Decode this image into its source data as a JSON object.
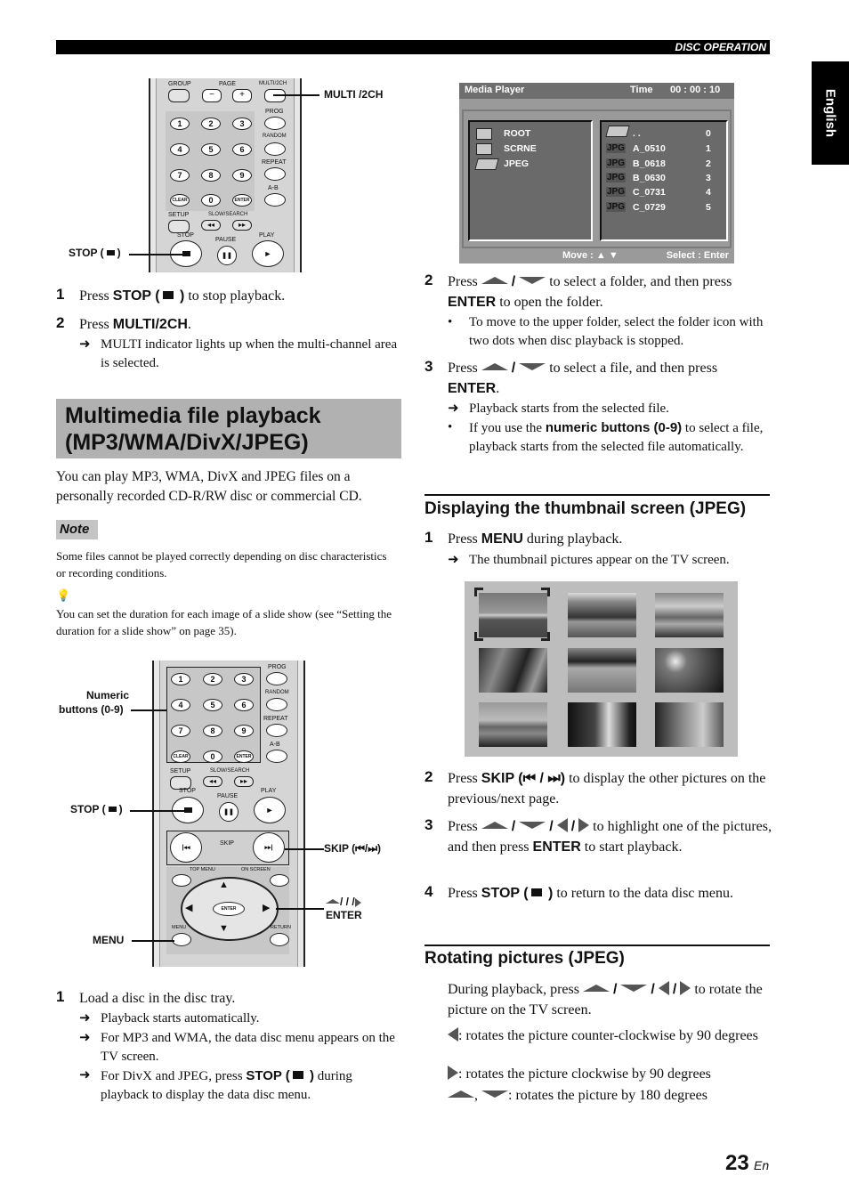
{
  "header": {
    "section": "DISC OPERATION",
    "language_tab": "English"
  },
  "remote_top": {
    "labels": {
      "group": "GROUP",
      "page": "PAGE",
      "multi2ch": "MULTI/2CH",
      "prog": "PROG",
      "random": "RANDOM",
      "repeat": "REPEAT",
      "ab": "A-B",
      "setup": "SETUP",
      "slow_search": "SLOW/SEARCH",
      "stop": "STOP",
      "pause": "PAUSE",
      "play": "PLAY",
      "clear": "CLEAR",
      "enter": "ENTER"
    },
    "numbers": [
      "1",
      "2",
      "3",
      "4",
      "5",
      "6",
      "7",
      "8",
      "9",
      "0"
    ],
    "page_minus": "−",
    "page_plus": "+",
    "callouts": {
      "multi": "MULTI /2CH",
      "stop": "STOP (",
      "stop_end": ")"
    }
  },
  "left_steps_top": [
    {
      "num": "1",
      "pre": "Press ",
      "bold": "STOP (",
      "bold_end": " )",
      "post": " to stop playback."
    },
    {
      "num": "2",
      "pre": "Press ",
      "bold": "MULTI/2CH",
      "post": ".",
      "result": "MULTI indicator lights up when the multi-channel area is selected."
    }
  ],
  "section": {
    "title_line1": "Multimedia file playback",
    "title_line2": "(MP3/WMA/DivX/JPEG)",
    "intro": "You can play MP3, WMA, DivX and JPEG files on a personally recorded CD-R/RW disc or commercial CD.",
    "note_label": "Note",
    "note_text": "Some files cannot be played correctly depending on disc characteristics or recording conditions.",
    "tip_icon": "lightbulb-tip-icon",
    "tip_text": "You can set the duration for each image of a slide show (see “Setting the duration for a slide show” on page 35)."
  },
  "remote_bottom": {
    "labels": {
      "prog": "PROG",
      "random": "RANDOM",
      "repeat": "REPEAT",
      "ab": "A-B",
      "clear": "CLEAR",
      "enter": "ENTER",
      "setup": "SETUP",
      "slow_search": "SLOW/SEARCH",
      "stop": "STOP",
      "pause": "PAUSE",
      "play": "PLAY",
      "skip": "SKIP",
      "top_menu": "TOP MENU",
      "on_screen": "ON SCREEN",
      "menu": "MENU",
      "return": "RETURN",
      "center_enter": "ENTER"
    },
    "numbers": [
      "1",
      "2",
      "3",
      "4",
      "5",
      "6",
      "7",
      "8",
      "9",
      "0"
    ],
    "callouts": {
      "numeric_1": "Numeric",
      "numeric_2": "buttons (0-9)",
      "stop": "STOP (",
      "stop_end": ")",
      "skip": "SKIP (⏮/⏭)",
      "cursor": "/ / /",
      "enter": "ENTER",
      "menu": "MENU"
    }
  },
  "left_steps_bottom": {
    "num": "1",
    "text": "Load a disc in the disc tray.",
    "results": [
      "Playback starts automatically.",
      "For MP3 and WMA, the data disc menu appears on the TV screen."
    ],
    "result3_pre": "For DivX and JPEG, press ",
    "result3_bold": "STOP (",
    "result3_bold_end": " )",
    "result3_post": " during playback to display the data disc menu."
  },
  "media_player": {
    "title": "Media Player",
    "time_label": "Time",
    "time_value": "00 : 00 : 10",
    "folders": [
      "ROOT",
      "SCRNE",
      "JPEG"
    ],
    "files": [
      {
        "icon": "folder-up",
        "name": ". .",
        "index": "0"
      },
      {
        "icon": "JPG",
        "name": "A_0510",
        "index": "1"
      },
      {
        "icon": "JPG",
        "name": "B_0618",
        "index": "2"
      },
      {
        "icon": "JPG",
        "name": "B_0630",
        "index": "3"
      },
      {
        "icon": "JPG",
        "name": "C_0731",
        "index": "4"
      },
      {
        "icon": "JPG",
        "name": "C_0729",
        "index": "5"
      }
    ],
    "footer_move": "Move : ▲ ▼",
    "footer_select": "Select : Enter"
  },
  "right_steps": {
    "step2": {
      "num": "2",
      "pre": "Press",
      "post": " to select a folder, and then press ",
      "bold": "ENTER",
      "post2": " to open the folder.",
      "bullet": "To move to the upper folder, select the folder icon with two dots when disc playback is stopped."
    },
    "step3": {
      "num": "3",
      "pre": "Press",
      "post": " to select a file, and then press ",
      "bold": "ENTER",
      "post2": ".",
      "result": "Playback starts from the selected file.",
      "bullet_pre": "If you use the ",
      "bullet_bold": "numeric buttons (0-9)",
      "bullet_post": " to select a file, playback starts from the selected file automatically."
    }
  },
  "thumbnail_section": {
    "heading": "Displaying the thumbnail screen (JPEG)",
    "step1": {
      "num": "1",
      "pre": "Press ",
      "bold": "MENU",
      "post": " during playback.",
      "result": "The thumbnail pictures appear on the TV screen."
    },
    "thumbnails": [
      "sunset-sea",
      "mountain-lake",
      "clouds-lake",
      "coastal-cliffs",
      "shore-hills",
      "sun-tree",
      "horizon-clouds",
      "palm-silhouettes",
      "cliff-river"
    ],
    "selected_index": 0,
    "step2": {
      "num": "2",
      "pre": "Press ",
      "bold": "SKIP (⏮ / ⏭)",
      "post": " to display the other pictures on the previous/next page."
    },
    "step3": {
      "num": "3",
      "pre": "Press",
      "post": " to highlight one of the pictures, and then press ",
      "bold": "ENTER",
      "post2": " to start playback."
    },
    "step4": {
      "num": "4",
      "pre": "Press ",
      "bold": "STOP (",
      "bold_end": " )",
      "post": " to return to the data disc menu."
    }
  },
  "rotating_section": {
    "heading": "Rotating pictures (JPEG)",
    "intro_pre": "During playback, press",
    "intro_post": " to rotate the picture on the TV screen.",
    "left_desc": ": rotates the picture counter-clockwise by 90 degrees",
    "right_desc": ": rotates the picture clockwise by 90 degrees",
    "updown_desc": ": rotates the picture by 180 degrees"
  },
  "footer": {
    "page_number": "23",
    "lang": "En"
  },
  "colors": {
    "section_band": "#b1b1b1",
    "screen_header": "#6e6e6e",
    "screen_panel": "#6a6a6a",
    "thumb_bg": "#bdbdbd"
  }
}
